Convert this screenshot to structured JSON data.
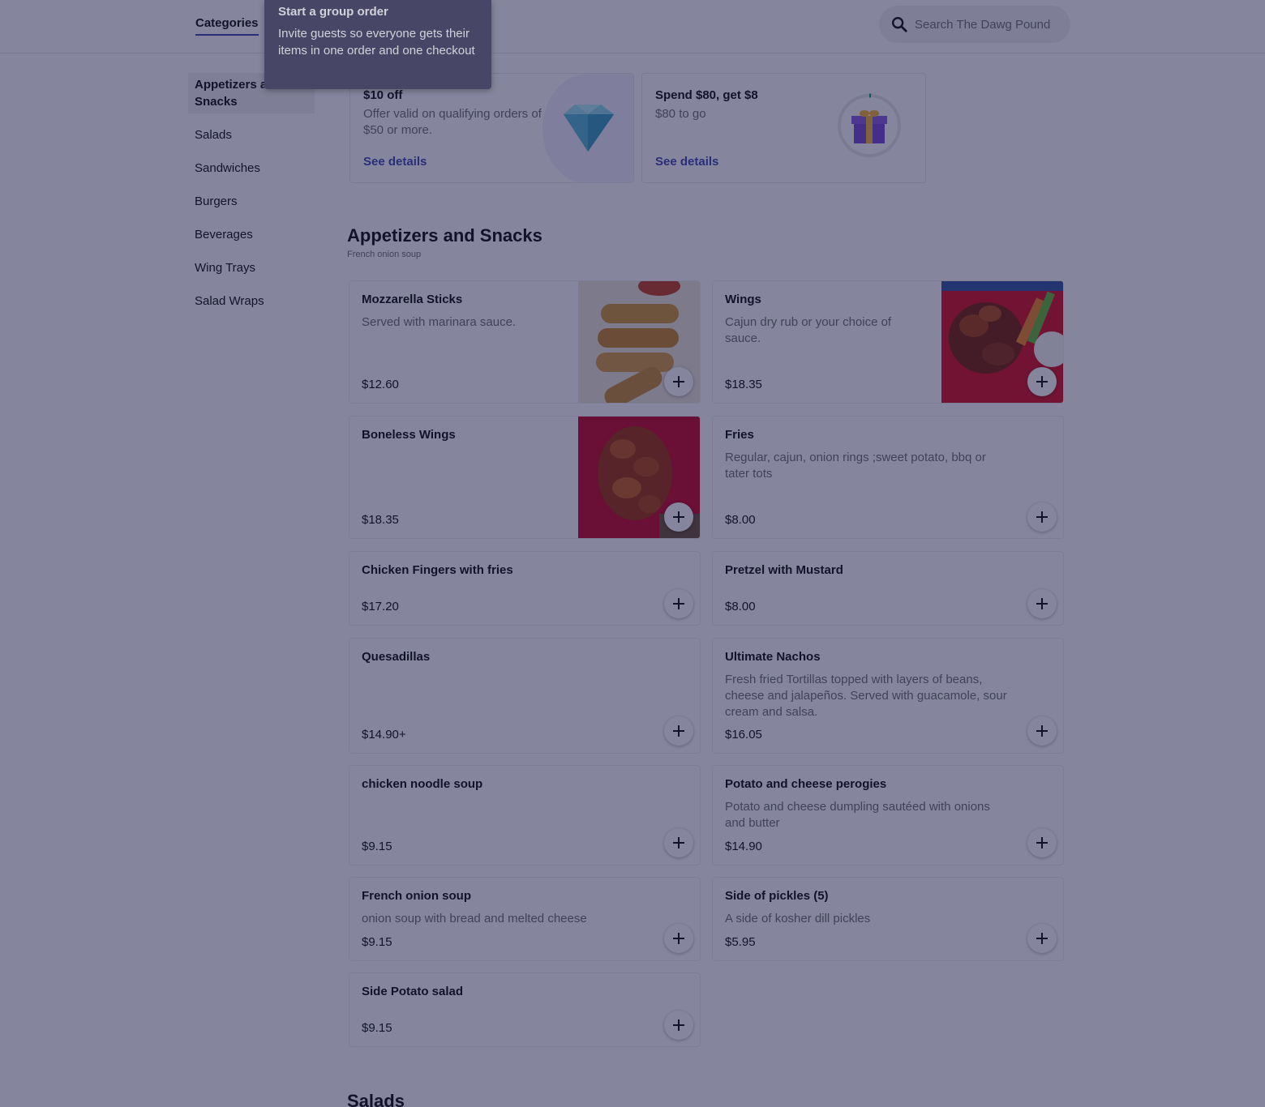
{
  "header": {
    "categories_tab": "Categories",
    "search_placeholder": "Search The Dawg Pound"
  },
  "sidebar": {
    "items": [
      {
        "label": "Appetizers and Snacks"
      },
      {
        "label": "Salads"
      },
      {
        "label": "Sandwiches"
      },
      {
        "label": "Burgers"
      },
      {
        "label": "Beverages"
      },
      {
        "label": "Wing Trays"
      },
      {
        "label": "Salad Wraps"
      }
    ]
  },
  "promos": [
    {
      "title": "$10 off",
      "desc": "Offer valid on qualifying orders of $50 or more.",
      "link": "See details",
      "icon": "diamond-icon"
    },
    {
      "title": "Spend $80, get $8",
      "desc": "$80 to go",
      "link": "See details",
      "icon": "gift-icon"
    }
  ],
  "section": {
    "title": "Appetizers and Snacks",
    "subtitle": "French onion soup",
    "next_title": "Salads"
  },
  "items": [
    {
      "name": "Mozzarella Sticks",
      "desc": "Served with marinara sauce.",
      "price": "$12.60"
    },
    {
      "name": "Wings",
      "desc": "Cajun dry rub or your choice of sauce.",
      "price": "$18.35"
    },
    {
      "name": "Boneless Wings",
      "desc": "",
      "price": "$18.35"
    },
    {
      "name": "Fries",
      "desc": "Regular, cajun, onion rings ;sweet potato, bbq or tater tots",
      "price": "$8.00"
    },
    {
      "name": "Chicken Fingers with fries",
      "desc": "",
      "price": "$17.20"
    },
    {
      "name": "Pretzel with Mustard",
      "desc": "",
      "price": "$8.00"
    },
    {
      "name": "Quesadillas",
      "desc": "",
      "price": "$14.90+"
    },
    {
      "name": "Ultimate Nachos",
      "desc": "Fresh fried Tortillas topped with layers of beans, cheese and jalapeños. Served with guacamole, sour cream and salsa.",
      "price": "$16.05"
    },
    {
      "name": "chicken noodle soup",
      "desc": "",
      "price": "$9.15"
    },
    {
      "name": "Potato and cheese perogies",
      "desc": "Potato and cheese dumpling sautéed with onions and butter",
      "price": "$14.90"
    },
    {
      "name": "French onion soup",
      "desc": "onion soup with bread and melted cheese",
      "price": "$9.15"
    },
    {
      "name": "Side of pickles (5)",
      "desc": "A side of kosher dill pickles",
      "price": "$5.95"
    },
    {
      "name": "Side Potato salad",
      "desc": "",
      "price": "$9.15"
    }
  ],
  "tooltip": {
    "title": "Start a group order",
    "body": "Invite guests so everyone gets their items in one order and one checkout"
  },
  "colors": {
    "accent": "#494fb7",
    "overlay": "#0c0e3c",
    "tooltip_bg": "#474666"
  }
}
